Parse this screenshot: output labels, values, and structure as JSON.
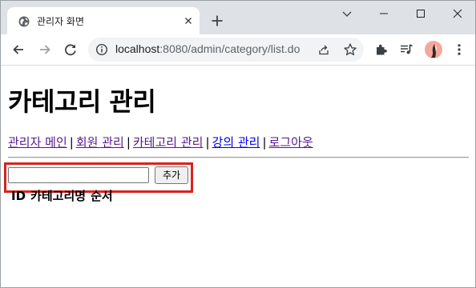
{
  "browser": {
    "tab": {
      "title": "관리자 화면",
      "favicon": "globe-icon"
    },
    "new_tab_icon": "plus-icon",
    "window_controls": [
      "chevron-down-icon",
      "minimize-icon",
      "maximize-icon",
      "close-icon"
    ],
    "address_bar": {
      "host": "localhost",
      "path": ":8080/admin/category/list.do",
      "info_icon": "info-icon",
      "share_icon": "share-icon",
      "bookmark_icon": "star-icon"
    },
    "toolbar_icons": [
      "back-icon",
      "forward-icon",
      "reload-icon",
      "extensions-icon",
      "media-queue-icon",
      "avatar",
      "menu-icon"
    ]
  },
  "page": {
    "title": "카테고리 관리",
    "nav": [
      {
        "label": "관리자 메인",
        "visited": true
      },
      {
        "label": "회원 관리",
        "visited": true
      },
      {
        "label": "카테고리 관리",
        "visited": true
      },
      {
        "label": "강의 관리",
        "visited": false
      },
      {
        "label": "로그아웃",
        "visited": true
      }
    ],
    "nav_separator": "|",
    "form": {
      "input_value": "",
      "add_label": "추가"
    },
    "table": {
      "headers": [
        "ID",
        "카테고리명",
        "순서"
      ]
    }
  },
  "colors": {
    "highlight_border": "#d9231e",
    "visited_link": "#551a8b",
    "unvisited_link": "#0000ee",
    "tabstrip": "#dee1e6",
    "omnibox": "#f1f3f4"
  }
}
